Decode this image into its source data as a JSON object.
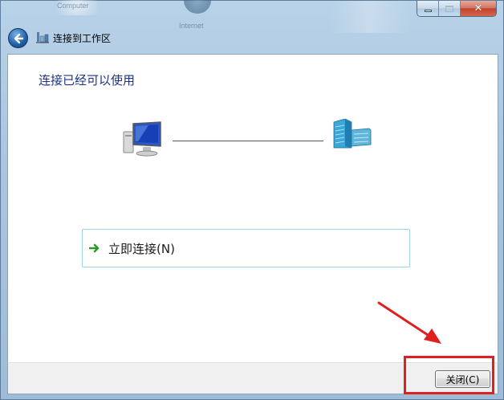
{
  "window": {
    "title": "连接到工作区",
    "bg_labels": [
      "Computer",
      "Internet"
    ]
  },
  "main": {
    "heading": "连接已经可以使用",
    "connect_label": "立即连接(N)"
  },
  "footer": {
    "close_label": "关闭(C)"
  },
  "icons": {
    "back": "back-arrow-icon",
    "title": "workplace-connection-icon",
    "computer": "computer-icon",
    "building": "building-icon",
    "arrow": "green-arrow-icon"
  },
  "colors": {
    "heading": "#1e3287",
    "annotation": "#e02020",
    "connect_border": "#9ed3e3"
  }
}
